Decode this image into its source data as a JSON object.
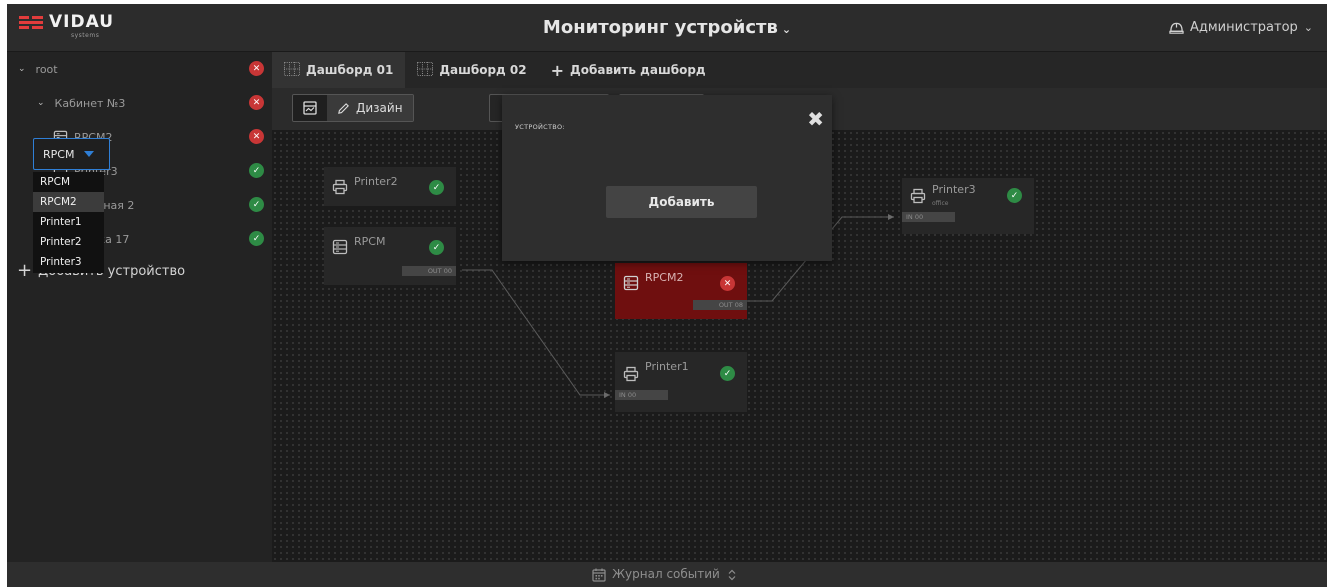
{
  "brand": {
    "name": "VIDAU",
    "sub": "systems",
    "logo_color": "#e23c3c"
  },
  "header": {
    "title": "Мониторинг устройств",
    "title_chevron": "⌄",
    "user": "Администратор",
    "user_chevron": "⌄",
    "user_icon": "helmet-icon"
  },
  "sidebar": {
    "items": [
      {
        "label": "root",
        "chevron": "⌄",
        "status": "error"
      },
      {
        "label": "Кабинет №3",
        "chevron": "⌄",
        "status": "error"
      },
      {
        "label": "RPCM2",
        "icon": "server-icon",
        "status": "error"
      },
      {
        "label": "Printer3",
        "icon": "printer-icon",
        "status": "ok"
      },
      {
        "label": "Аппаратная 2",
        "chevron": "⌄",
        "status": "ok"
      },
      {
        "label": "Стойка 17",
        "chevron": "⌄",
        "status": "ok"
      }
    ],
    "add_device": "Добавить устройство",
    "add_symbol": "+"
  },
  "tabs": [
    {
      "label": "Дашборд 01",
      "active": true
    },
    {
      "label": "Дашборд 02",
      "active": false
    }
  ],
  "add_tab": {
    "label": "Добавить дашборд",
    "symbol": "+"
  },
  "toolbar": {
    "design_label": "Дизайн"
  },
  "canvas": {
    "nodes": [
      {
        "name": "Printer2",
        "icon": "printer-icon",
        "status": "ok"
      },
      {
        "name": "RPCM",
        "icon": "server-icon",
        "status": "ok",
        "port": "OUT 00"
      },
      {
        "name": "RPCM2",
        "icon": "server-icon",
        "status": "error",
        "port": "OUT 08"
      },
      {
        "name": "Printer1",
        "icon": "printer-icon",
        "status": "ok",
        "port": "IN 00"
      },
      {
        "name": "Printer3",
        "sub": "office",
        "icon": "printer-icon",
        "status": "ok",
        "port": "IN 00"
      }
    ]
  },
  "modal": {
    "label": "УСТРОЙСТВО:",
    "select_value": "RPCM",
    "options": [
      "RPCM",
      "RPCM2",
      "Printer1",
      "Printer2",
      "Printer3"
    ],
    "highlighted_option": "RPCM2",
    "add_button": "Добавить",
    "close_symbol": "✖"
  },
  "footer": {
    "label": "Журнал событий",
    "toggle": "⌃⌄"
  },
  "status_symbols": {
    "ok": "✓",
    "error": "✕"
  },
  "colors": {
    "ok": "#2e8b45",
    "error": "#c83636",
    "alarm_node": "#6f0f0f",
    "accent": "#2f7fd6"
  }
}
